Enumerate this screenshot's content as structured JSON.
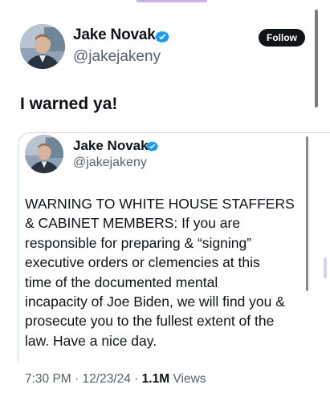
{
  "tweet": {
    "author": {
      "name": "Jake Novak",
      "handle": "@jakejakeny",
      "verified_color": "#1d9bf0"
    },
    "follow_label": "Follow",
    "text": "I warned ya!"
  },
  "quoted_tweet": {
    "author": {
      "name": "Jake Novak",
      "handle": "@jakejakeny"
    },
    "lines": [
      "WARNING TO WHITE HOUSE STAFFERS",
      "& CABINET MEMBERS: If you are",
      "responsible for preparing & “signing”",
      "executive orders or clemencies at this",
      "time of the documented mental",
      "incapacity of Joe Biden, we will find you &",
      "prosecute you to the fullest extent of the",
      "law. Have a nice day."
    ],
    "time": "7:30 PM",
    "separator": "·",
    "date": "12/23/24",
    "views_count": "1.1M",
    "views_label": "Views"
  },
  "icons": {
    "verified": "verified-badge-icon",
    "avatar": "avatar-photo"
  }
}
